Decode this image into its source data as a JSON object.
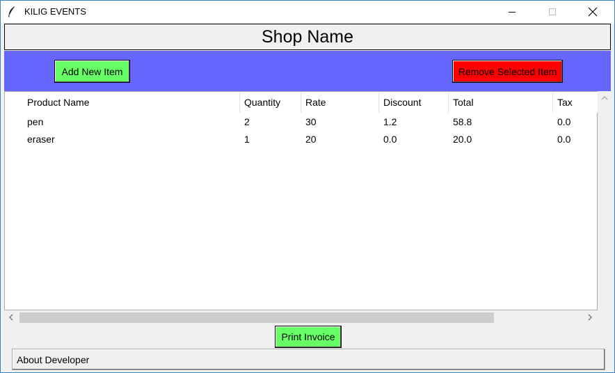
{
  "window": {
    "title": "KILIG EVENTS",
    "icon": "feather-icon",
    "controls": [
      "minimize-icon",
      "maximize-icon",
      "close-icon"
    ]
  },
  "header": {
    "shop_name": "Shop Name"
  },
  "toolbar": {
    "add_label": "Add New Item",
    "remove_label": "Remove Selected Item",
    "bar_color": "#6666ff",
    "add_color": "#66ff66",
    "remove_color": "#ff0000"
  },
  "table": {
    "columns": [
      "Product Name",
      "Quantity",
      "Rate",
      "Discount",
      "Total",
      "Tax"
    ],
    "rows": [
      [
        "pen",
        "2",
        "30",
        "1.2",
        "58.8",
        "0.0"
      ],
      [
        "eraser",
        "1",
        "20",
        "0.0",
        "20.0",
        "0.0"
      ]
    ]
  },
  "footer": {
    "print_label": "Print Invoice",
    "about_label": "About Developer"
  }
}
